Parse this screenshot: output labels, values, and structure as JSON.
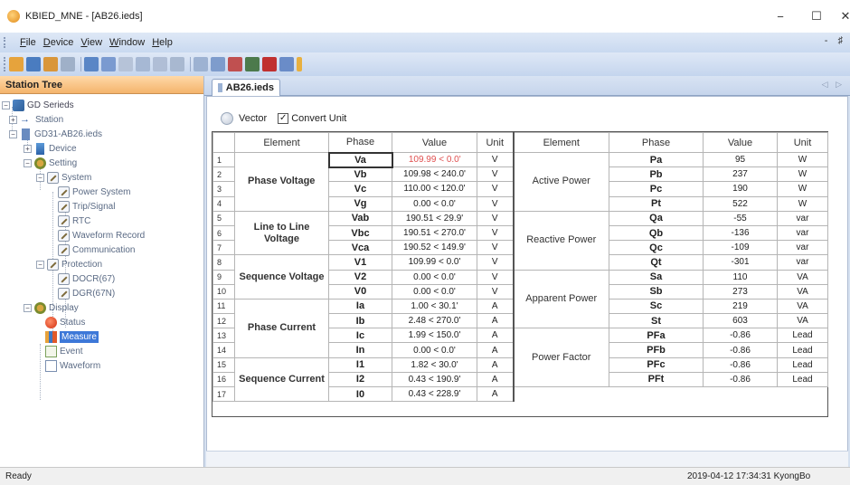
{
  "window": {
    "title": "KBIED_MNE - [AB26.ieds]",
    "minimize": "−",
    "maximize": "☐",
    "close": "✕"
  },
  "menu": {
    "items": [
      "File",
      "Device",
      "View",
      "Window",
      "Help"
    ],
    "mdi_controls": "- ♯"
  },
  "left_panel": {
    "title": "Station Tree",
    "tree": {
      "root": "GD Serieds",
      "station": "Station",
      "file": "GD31-AB26.ieds",
      "device": "Device",
      "setting": "Setting",
      "system": "System",
      "power_system": "Power System",
      "trip_signal": "Trip/Signal",
      "rtc": "RTC",
      "waveform_record": "Waveform Record",
      "communication": "Communication",
      "protection": "Protection",
      "docr": "DOCR(67)",
      "dgr": "DGR(67N)",
      "display": "Display",
      "status": "Status",
      "measure": "Measure",
      "event": "Event",
      "waveform": "Waveform"
    }
  },
  "document": {
    "tab_label": "AB26.ieds",
    "vector_label": "Vector",
    "convert_unit_label": "Convert Unit",
    "convert_unit_checked": "✓"
  },
  "table": {
    "headers": [
      "Element",
      "Phase",
      "Value",
      "Unit",
      "Element",
      "Phase",
      "Value",
      "Unit"
    ],
    "left_groups": [
      "Phase Voltage",
      "Line to Line Voltage",
      "Sequence Voltage",
      "Phase Current",
      "Sequence Current"
    ],
    "right_groups": [
      "Active Power",
      "Reactive Power",
      "Apparent Power",
      "Power Factor"
    ],
    "left_rows": [
      {
        "n": "1",
        "phase": "Va",
        "value": "109.99 < 0.0'",
        "unit": "V"
      },
      {
        "n": "2",
        "phase": "Vb",
        "value": "109.98 < 240.0'",
        "unit": "V"
      },
      {
        "n": "3",
        "phase": "Vc",
        "value": "110.00 < 120.0'",
        "unit": "V"
      },
      {
        "n": "4",
        "phase": "Vg",
        "value": "0.00 < 0.0'",
        "unit": "V"
      },
      {
        "n": "5",
        "phase": "Vab",
        "value": "190.51 < 29.9'",
        "unit": "V"
      },
      {
        "n": "6",
        "phase": "Vbc",
        "value": "190.51 < 270.0'",
        "unit": "V"
      },
      {
        "n": "7",
        "phase": "Vca",
        "value": "190.52 < 149.9'",
        "unit": "V"
      },
      {
        "n": "8",
        "phase": "V1",
        "value": "109.99 < 0.0'",
        "unit": "V"
      },
      {
        "n": "9",
        "phase": "V2",
        "value": "0.00 < 0.0'",
        "unit": "V"
      },
      {
        "n": "10",
        "phase": "V0",
        "value": "0.00 < 0.0'",
        "unit": "V"
      },
      {
        "n": "11",
        "phase": "Ia",
        "value": "1.00 < 30.1'",
        "unit": "A"
      },
      {
        "n": "12",
        "phase": "Ib",
        "value": "2.48 < 270.0'",
        "unit": "A"
      },
      {
        "n": "13",
        "phase": "Ic",
        "value": "1.99 < 150.0'",
        "unit": "A"
      },
      {
        "n": "14",
        "phase": "In",
        "value": "0.00 < 0.0'",
        "unit": "A"
      },
      {
        "n": "15",
        "phase": "I1",
        "value": "1.82 < 30.0'",
        "unit": "A"
      },
      {
        "n": "16",
        "phase": "I2",
        "value": "0.43 < 190.9'",
        "unit": "A"
      },
      {
        "n": "17",
        "phase": "I0",
        "value": "0.43 < 228.9'",
        "unit": "A"
      }
    ],
    "right_rows": [
      {
        "phase": "Pa",
        "value": "95",
        "unit": "W"
      },
      {
        "phase": "Pb",
        "value": "237",
        "unit": "W"
      },
      {
        "phase": "Pc",
        "value": "190",
        "unit": "W"
      },
      {
        "phase": "Pt",
        "value": "522",
        "unit": "W"
      },
      {
        "phase": "Qa",
        "value": "-55",
        "unit": "var"
      },
      {
        "phase": "Qb",
        "value": "-136",
        "unit": "var"
      },
      {
        "phase": "Qc",
        "value": "-109",
        "unit": "var"
      },
      {
        "phase": "Qt",
        "value": "-301",
        "unit": "var"
      },
      {
        "phase": "Sa",
        "value": "110",
        "unit": "VA"
      },
      {
        "phase": "Sb",
        "value": "273",
        "unit": "VA"
      },
      {
        "phase": "Sc",
        "value": "219",
        "unit": "VA"
      },
      {
        "phase": "St",
        "value": "603",
        "unit": "VA"
      },
      {
        "phase": "PFa",
        "value": "-0.86",
        "unit": "Lead"
      },
      {
        "phase": "PFb",
        "value": "-0.86",
        "unit": "Lead"
      },
      {
        "phase": "PFc",
        "value": "-0.86",
        "unit": "Lead"
      },
      {
        "phase": "PFt",
        "value": "-0.86",
        "unit": "Lead"
      }
    ]
  },
  "status": {
    "left": "Ready",
    "right": "2019-04-12 17:34:31  KyongBo"
  },
  "colors": {
    "highlight_value": "#e05050",
    "panel_header": "#f4b46c",
    "selection": "#3d78d8"
  }
}
